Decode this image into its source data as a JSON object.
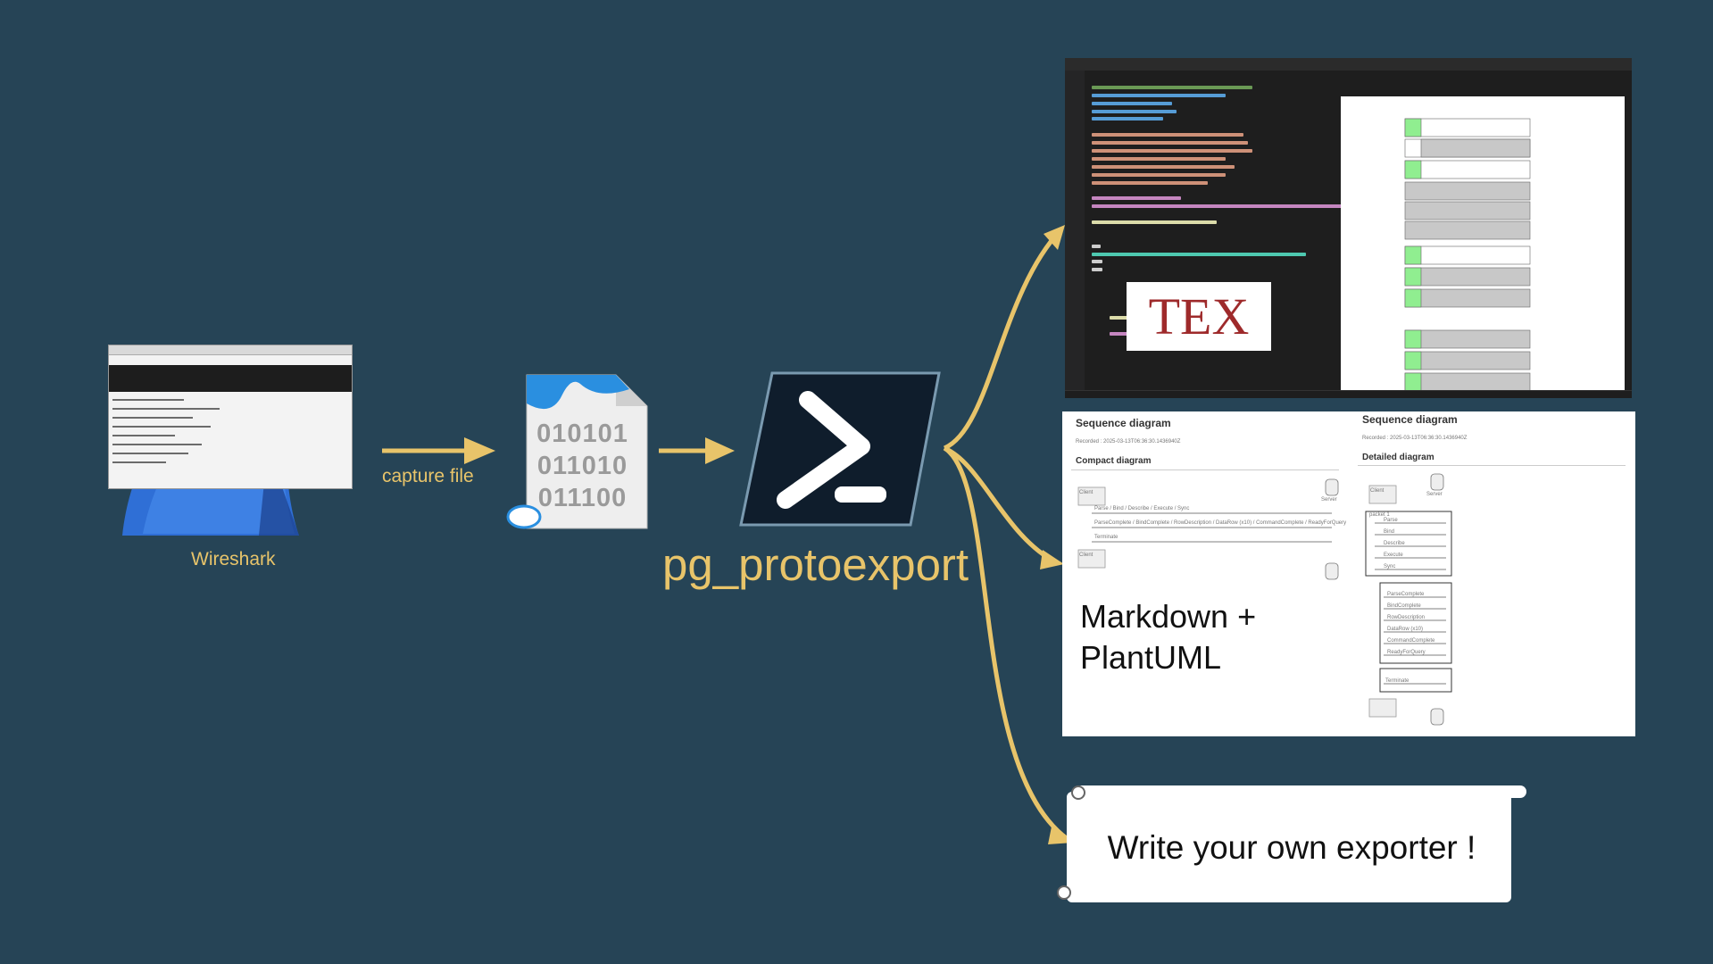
{
  "labels": {
    "wireshark": "Wireshark",
    "capture_file": "capture file",
    "tool_name": "pg_protoexport",
    "markdown_plantuml_line1": "Markdown +",
    "markdown_plantuml_line2": "PlantUML",
    "own_exporter": "Write your own exporter !"
  },
  "file_icon": {
    "digits": [
      "010101",
      "011010",
      "011100"
    ]
  },
  "tex_logo": "TEX",
  "plantuml": {
    "left_title": "Sequence diagram",
    "right_title": "Sequence diagram",
    "recorded": "Recorded : 2025-03-13T06:36:30.1436940Z",
    "compact_label": "Compact diagram",
    "detailed_label": "Detailed diagram",
    "client": "Client",
    "server": "Server",
    "compact_msgs": [
      "Parse / Bind / Describe / Execute / Sync",
      "ParseComplete / BindComplete / RowDescription / DataRow (x10) / CommandComplete / ReadyForQuery",
      "Terminate"
    ],
    "detailed_msgs": [
      "Parse",
      "Bind",
      "Describe",
      "Execute",
      "Sync"
    ],
    "detailed_replies": [
      "ParseComplete",
      "BindComplete",
      "RowDescription",
      "DataRow (x10)",
      "CommandComplete",
      "ReadyForQuery"
    ],
    "packet1": "packet 1",
    "terminate": "Terminate"
  },
  "colors": {
    "background": "#264456",
    "accent_gold": "#e8c46a",
    "tex_red": "#9e2a2b",
    "shark_blue": "#2f6fd6"
  }
}
